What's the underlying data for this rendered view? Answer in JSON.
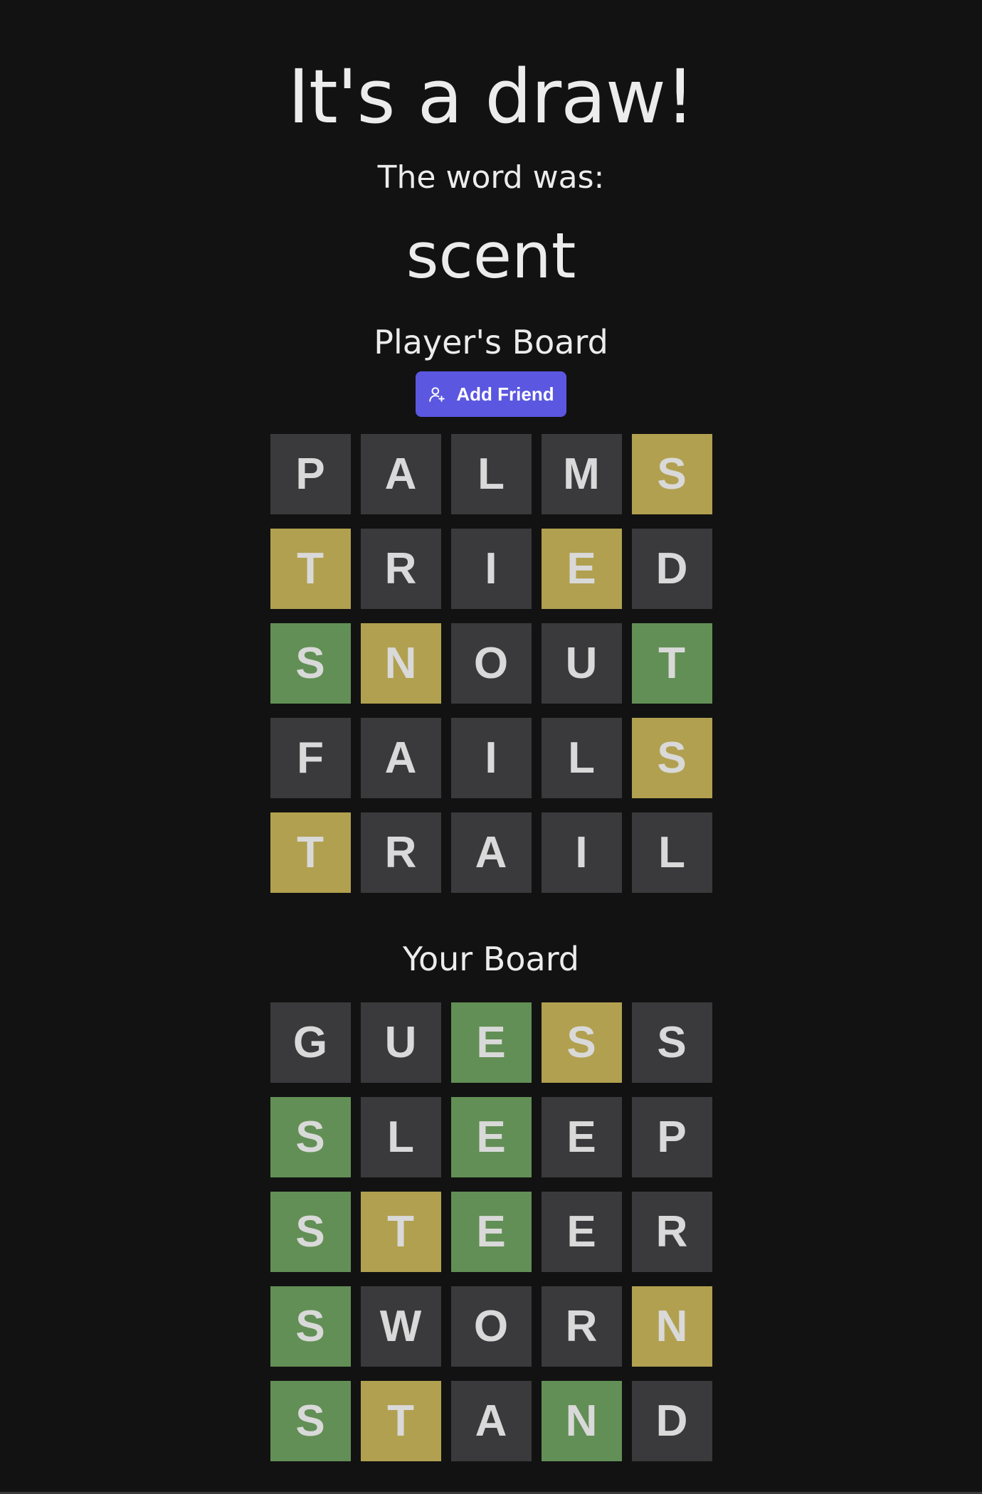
{
  "result": {
    "headline": "It's a draw!",
    "word_label": "The word was:",
    "word": "scent"
  },
  "players_board": {
    "title": "Player's Board",
    "add_friend_label": "Add Friend",
    "rows": [
      [
        {
          "letter": "P",
          "state": "absent"
        },
        {
          "letter": "A",
          "state": "absent"
        },
        {
          "letter": "L",
          "state": "absent"
        },
        {
          "letter": "M",
          "state": "absent"
        },
        {
          "letter": "S",
          "state": "present"
        }
      ],
      [
        {
          "letter": "T",
          "state": "present"
        },
        {
          "letter": "R",
          "state": "absent"
        },
        {
          "letter": "I",
          "state": "absent"
        },
        {
          "letter": "E",
          "state": "present"
        },
        {
          "letter": "D",
          "state": "absent"
        }
      ],
      [
        {
          "letter": "S",
          "state": "correct"
        },
        {
          "letter": "N",
          "state": "present"
        },
        {
          "letter": "O",
          "state": "absent"
        },
        {
          "letter": "U",
          "state": "absent"
        },
        {
          "letter": "T",
          "state": "correct"
        }
      ],
      [
        {
          "letter": "F",
          "state": "absent"
        },
        {
          "letter": "A",
          "state": "absent"
        },
        {
          "letter": "I",
          "state": "absent"
        },
        {
          "letter": "L",
          "state": "absent"
        },
        {
          "letter": "S",
          "state": "present"
        }
      ],
      [
        {
          "letter": "T",
          "state": "present"
        },
        {
          "letter": "R",
          "state": "absent"
        },
        {
          "letter": "A",
          "state": "absent"
        },
        {
          "letter": "I",
          "state": "absent"
        },
        {
          "letter": "L",
          "state": "absent"
        }
      ]
    ]
  },
  "your_board": {
    "title": "Your Board",
    "rows": [
      [
        {
          "letter": "G",
          "state": "absent"
        },
        {
          "letter": "U",
          "state": "absent"
        },
        {
          "letter": "E",
          "state": "correct"
        },
        {
          "letter": "S",
          "state": "present"
        },
        {
          "letter": "S",
          "state": "absent"
        }
      ],
      [
        {
          "letter": "S",
          "state": "correct"
        },
        {
          "letter": "L",
          "state": "absent"
        },
        {
          "letter": "E",
          "state": "correct"
        },
        {
          "letter": "E",
          "state": "absent"
        },
        {
          "letter": "P",
          "state": "absent"
        }
      ],
      [
        {
          "letter": "S",
          "state": "correct"
        },
        {
          "letter": "T",
          "state": "present"
        },
        {
          "letter": "E",
          "state": "correct"
        },
        {
          "letter": "E",
          "state": "absent"
        },
        {
          "letter": "R",
          "state": "absent"
        }
      ],
      [
        {
          "letter": "S",
          "state": "correct"
        },
        {
          "letter": "W",
          "state": "absent"
        },
        {
          "letter": "O",
          "state": "absent"
        },
        {
          "letter": "R",
          "state": "absent"
        },
        {
          "letter": "N",
          "state": "present"
        }
      ],
      [
        {
          "letter": "S",
          "state": "correct"
        },
        {
          "letter": "T",
          "state": "present"
        },
        {
          "letter": "A",
          "state": "absent"
        },
        {
          "letter": "N",
          "state": "correct"
        },
        {
          "letter": "D",
          "state": "absent"
        }
      ]
    ]
  },
  "icons": {
    "add_friend": "user-plus-icon"
  },
  "colors": {
    "background": "#121212",
    "absent": "#3a3a3c",
    "present": "#b1a04f",
    "correct": "#628f55",
    "button": "#5b57e0",
    "text": "#ececec"
  }
}
